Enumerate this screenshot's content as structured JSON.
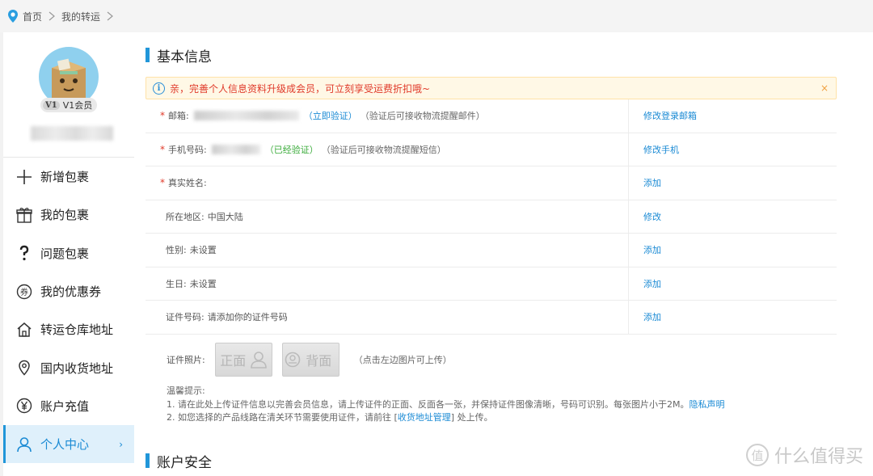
{
  "breadcrumb": {
    "home": "首页",
    "current": "我的转运"
  },
  "profile": {
    "level_badge": "V1",
    "level_text": "V1会员"
  },
  "nav": [
    {
      "label": "新增包裹",
      "icon": "plus-icon"
    },
    {
      "label": "我的包裹",
      "icon": "gift-box-icon"
    },
    {
      "label": "问题包裹",
      "icon": "question-icon"
    },
    {
      "label": "我的优惠券",
      "icon": "coupon-icon"
    },
    {
      "label": "转运仓库地址",
      "icon": "warehouse-icon"
    },
    {
      "label": "国内收货地址",
      "icon": "location-pin-icon"
    },
    {
      "label": "账户充值",
      "icon": "yen-icon"
    },
    {
      "label": "个人中心",
      "icon": "user-icon",
      "active": true
    }
  ],
  "section1": {
    "title": "基本信息"
  },
  "notice": {
    "text": "亲，完善个人信息资料升级成会员，可立刻享受运费折扣哦~",
    "close": "×"
  },
  "rows": [
    {
      "required": "*",
      "key": "邮箱:",
      "status": "（立即验证）",
      "hint": "（验证后可接收物流提醒邮件）",
      "action": "修改登录邮箱"
    },
    {
      "required": "*",
      "key": "手机号码:",
      "status": "（已经验证）",
      "hint": "（验证后可接收物流提醒短信）",
      "action": "修改手机"
    },
    {
      "required": "*",
      "key": "真实姓名:",
      "action": "添加"
    },
    {
      "key": "所在地区:",
      "value": "中国大陆",
      "action": "修改"
    },
    {
      "key": "性别:",
      "value": "未设置",
      "action": "添加"
    },
    {
      "key": "生日:",
      "value": "未设置",
      "action": "添加"
    },
    {
      "key": "证件号码:",
      "value": "请添加你的证件号码",
      "action": "添加"
    }
  ],
  "photo": {
    "label": "证件照片:",
    "front": "正面",
    "back": "背面",
    "hint": "（点击左边图片可上传）"
  },
  "tips": {
    "title": "温馨提示:",
    "line1": "1. 请在此处上传证件信息以完善会员信息，请上传证件的正面、反面各一张，并保持证件图像清晰，号码可识别。每张图片小于2M。",
    "line1_link": "隐私声明",
    "line2_a": "2. 如您选择的产品线路在清关环节需要使用证件，请前往 [",
    "line2_link": "收货地址管理",
    "line2_b": "] 处上传。"
  },
  "section2": {
    "title": "账户安全"
  },
  "watermark": "值 什么值得买",
  "colors": {
    "accent": "#2196d9",
    "required": "#e03a2a",
    "verified": "#3aab3a"
  }
}
